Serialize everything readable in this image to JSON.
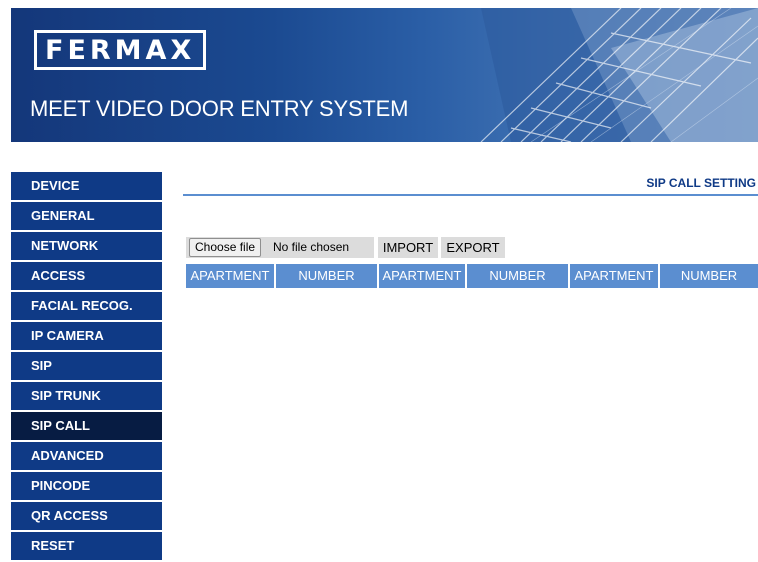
{
  "header": {
    "logo_text": "FERMAX",
    "product_title": "MEET VIDEO DOOR ENTRY SYSTEM"
  },
  "sidebar": {
    "items": [
      {
        "label": "DEVICE"
      },
      {
        "label": "GENERAL"
      },
      {
        "label": "NETWORK"
      },
      {
        "label": "ACCESS"
      },
      {
        "label": "FACIAL RECOG."
      },
      {
        "label": "IP CAMERA"
      },
      {
        "label": "SIP"
      },
      {
        "label": "SIP TRUNK"
      },
      {
        "label": "SIP CALL",
        "active": true
      },
      {
        "label": "ADVANCED"
      },
      {
        "label": "PINCODE"
      },
      {
        "label": "QR ACCESS"
      },
      {
        "label": "RESET"
      }
    ]
  },
  "main": {
    "section_title": "SIP CALL SETTING",
    "file_input": {
      "button_label": "Choose file",
      "status_text": "No file chosen"
    },
    "import_label": "IMPORT",
    "export_label": "EXPORT",
    "table": {
      "headers": [
        "APARTMENT",
        "NUMBER",
        "APARTMENT",
        "NUMBER",
        "APARTMENT",
        "NUMBER"
      ]
    }
  },
  "colors": {
    "nav_bg": "#0f3a86",
    "nav_active_bg": "#071c43",
    "table_header_bg": "#5b8ed0",
    "title_text": "#0f3a86"
  }
}
